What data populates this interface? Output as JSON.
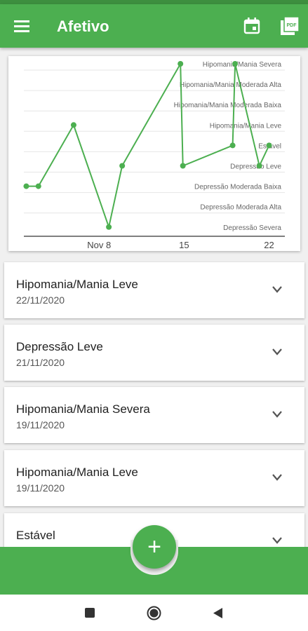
{
  "app_bar": {
    "title": "Afetivo",
    "menu_icon": "hamburger-menu-icon",
    "calendar_icon": "calendar-icon",
    "pdf_icon": "pdf-icon",
    "color": "#4caf50"
  },
  "chart_data": {
    "type": "line",
    "y_levels": [
      "Hipomania/Mania Severa",
      "Hipomania/Mania Moderada Alta",
      "Hipomania/Mania Moderada Baixa",
      "Hipomania/Mania Leve",
      "Estável",
      "Depressão Leve",
      "Depressão Moderada Baixa",
      "Depressão Moderada Alta",
      "Depressão Severa"
    ],
    "x_ticks": [
      "Nov 8",
      "15",
      "22"
    ],
    "x_tick_days": [
      8,
      15,
      22
    ],
    "x_range": [
      1.8,
      23.3
    ],
    "points": [
      {
        "day": 2.0,
        "level": "Depressão Moderada Baixa"
      },
      {
        "day": 3.0,
        "level": "Depressão Moderada Baixa"
      },
      {
        "day": 5.9,
        "level": "Hipomania/Mania Leve"
      },
      {
        "day": 8.8,
        "level": "Depressão Severa"
      },
      {
        "day": 9.9,
        "level": "Depressão Leve"
      },
      {
        "day": 14.7,
        "level": "Hipomania/Mania Severa"
      },
      {
        "day": 14.9,
        "level": "Depressão Leve"
      },
      {
        "day": 19.0,
        "level": "Estável"
      },
      {
        "day": 19.2,
        "level": "Hipomania/Mania Severa"
      },
      {
        "day": 21.2,
        "level": "Depressão Leve"
      },
      {
        "day": 22.0,
        "level": "Estável"
      }
    ],
    "series_color": "#4caf50",
    "grid": true
  },
  "entries": [
    {
      "mood": "Hipomania/Mania Leve",
      "date": "22/11/2020"
    },
    {
      "mood": "Depressão Leve",
      "date": "21/11/2020"
    },
    {
      "mood": "Hipomania/Mania Severa",
      "date": "19/11/2020"
    },
    {
      "mood": "Hipomania/Mania Leve",
      "date": "19/11/2020"
    },
    {
      "mood": "Estável",
      "date": ""
    }
  ],
  "fab": {
    "label": "+",
    "icon": "add-icon"
  },
  "system_nav": {
    "recents_icon": "square-icon",
    "home_icon": "circle-icon",
    "back_icon": "triangle-back-icon"
  }
}
